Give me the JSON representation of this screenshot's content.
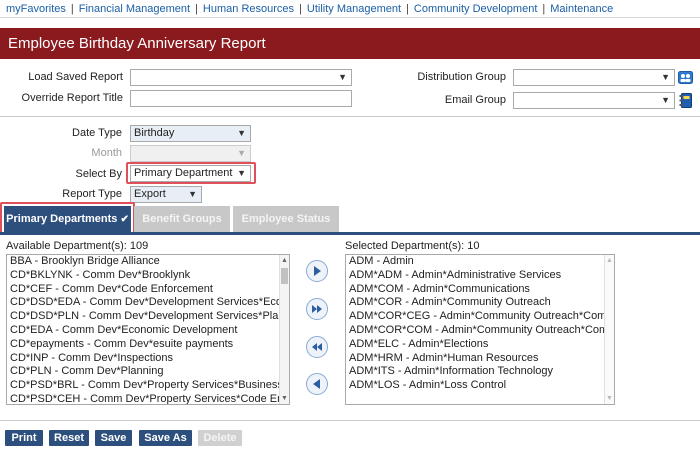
{
  "nav": {
    "items": [
      "myFavorites",
      "Financial Management",
      "Human Resources",
      "Utility Management",
      "Community Development",
      "Maintenance"
    ]
  },
  "page": {
    "title": "Employee Birthday Anniversary Report"
  },
  "form": {
    "load_saved_report_label": "Load Saved Report",
    "override_report_title_label": "Override Report Title",
    "distribution_group_label": "Distribution Group",
    "email_group_label": "Email Group",
    "date_type_label": "Date Type",
    "date_type_value": "Birthday",
    "month_label": "Month",
    "select_by_label": "Select By",
    "select_by_value": "Primary Department",
    "report_type_label": "Report Type",
    "report_type_value": "Export"
  },
  "tabs": [
    {
      "label": "Primary Departments",
      "active": true
    },
    {
      "label": "Benefit Groups",
      "active": false
    },
    {
      "label": "Employee Status",
      "active": false
    }
  ],
  "available": {
    "label": "Available Department(s): 109",
    "items": [
      "BBA - Brooklyn Bridge Alliance",
      "CD*BKLYNK - Comm Dev*Brooklynk",
      "CD*CEF - Comm Dev*Code Enforcement",
      "CD*DSD*EDA - Comm Dev*Development Services*Economic",
      "CD*DSD*PLN - Comm Dev*Development Services*Planning",
      "CD*EDA - Comm Dev*Economic Development",
      "CD*epayments - Comm Dev*esuite payments",
      "CD*INP - Comm Dev*Inspections",
      "CD*PLN - Comm Dev*Planning",
      "CD*PSD*BRL - Comm Dev*Property Services*Business & Re",
      "CD*PSD*CEH - Comm Dev*Property Services*Code Enforcer"
    ]
  },
  "selected": {
    "label": "Selected Department(s): 10",
    "items": [
      "ADM - Admin",
      "ADM*ADM - Admin*Administrative Services",
      "ADM*COM - Admin*Communications",
      "ADM*COR - Admin*Community Outreach",
      "ADM*COR*CEG - Admin*Community Outreach*Community",
      "ADM*COR*COM - Admin*Community Outreach*Communic",
      "ADM*ELC - Admin*Elections",
      "ADM*HRM - Admin*Human Resources",
      "ADM*ITS - Admin*Information Technology",
      "ADM*LOS - Admin*Loss Control"
    ]
  },
  "buttons": {
    "print": "Print",
    "reset": "Reset",
    "save": "Save",
    "save_as": "Save As",
    "delete": "Delete"
  },
  "colors": {
    "banner": "#8b1a1f",
    "accent": "#2d4f7e",
    "highlight": "#e0505a"
  }
}
